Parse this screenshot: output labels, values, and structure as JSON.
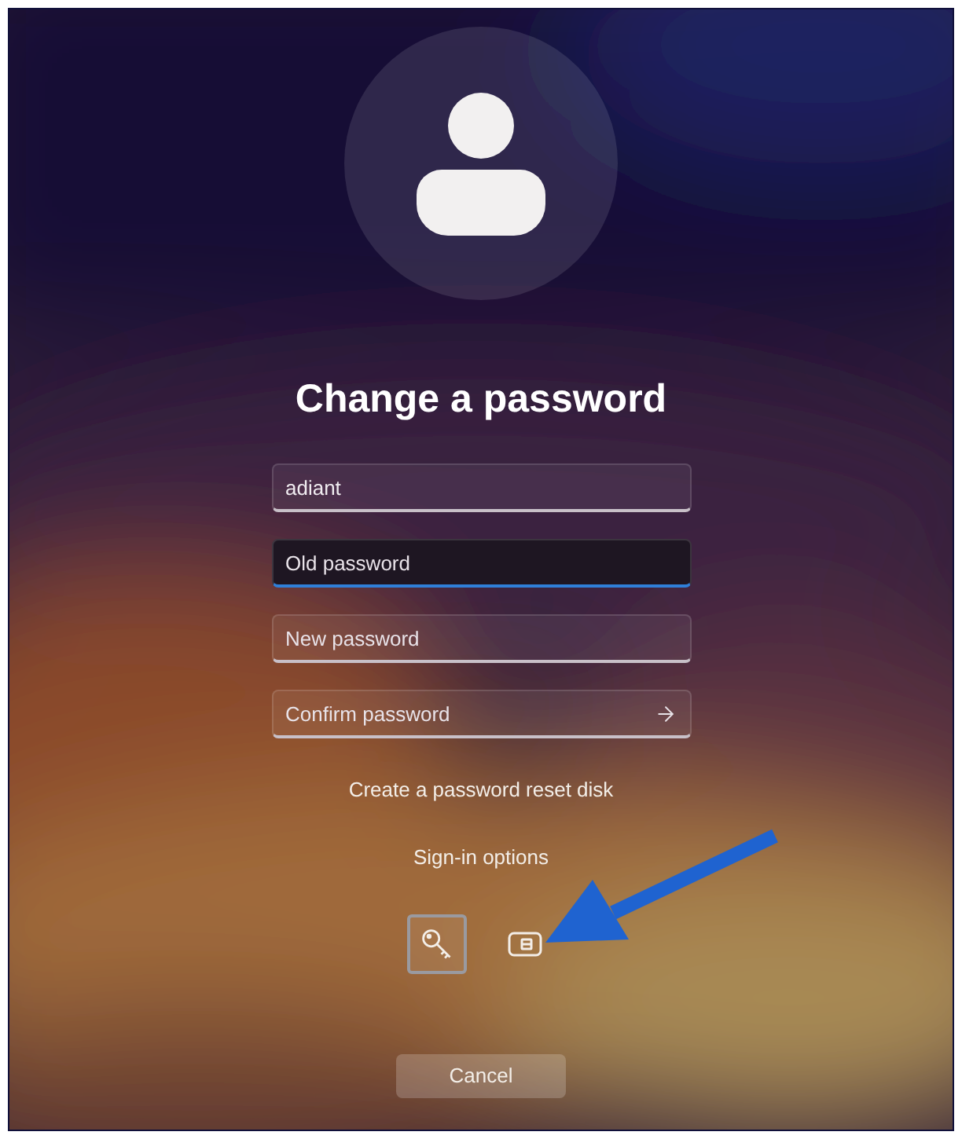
{
  "title": "Change a password",
  "fields": [
    {
      "value": "adiant",
      "focused": false,
      "submit": false
    },
    {
      "placeholder": "Old password",
      "focused": true,
      "submit": false
    },
    {
      "placeholder": "New password",
      "focused": false,
      "submit": false
    },
    {
      "placeholder": "Confirm password",
      "focused": false,
      "submit": true
    }
  ],
  "reset_link": "Create a password reset disk",
  "sign_in_options": {
    "label": "Sign-in options",
    "options": [
      {
        "kind": "password",
        "selected": true
      },
      {
        "kind": "card",
        "selected": false
      }
    ]
  },
  "cancel": "Cancel"
}
